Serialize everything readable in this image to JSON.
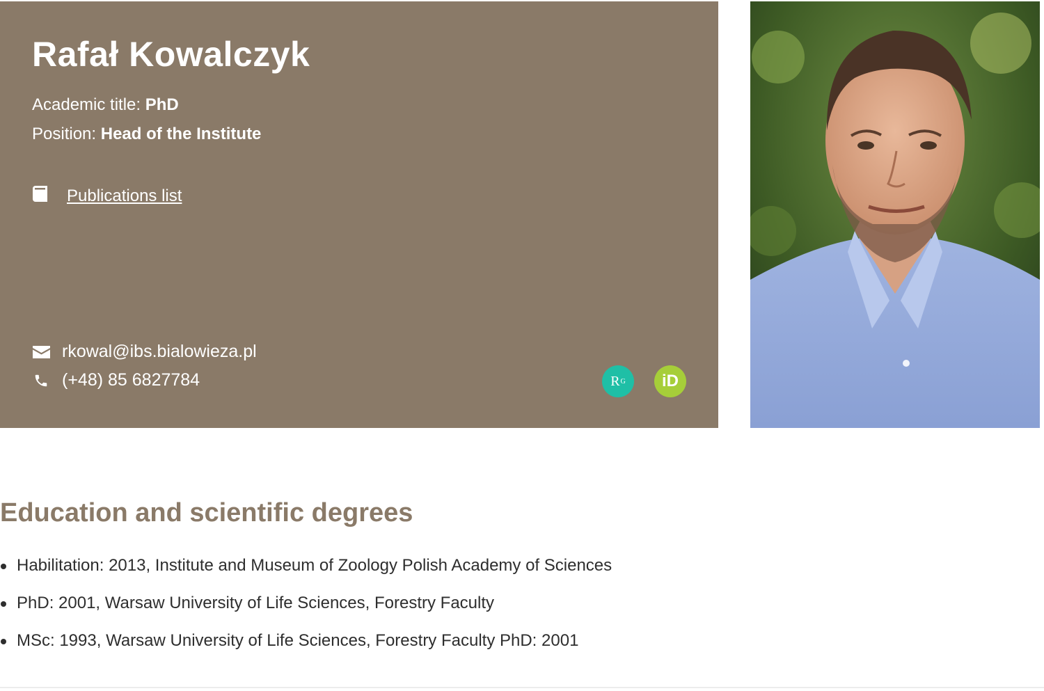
{
  "profile": {
    "name": "Rafał Kowalczyk",
    "academic_title_label": "Academic title:",
    "academic_title_value": "PhD",
    "position_label": "Position:",
    "position_value": "Head of the Institute",
    "publications_link": "Publications list",
    "email": "rkowal@ibs.bialowieza.pl",
    "phone": "(+48) 85 6827784",
    "researchgate_badge": "R",
    "researchgate_sup": "G",
    "orcid_badge": "iD",
    "card_color": "#8a7a68"
  },
  "icons": {
    "publications": "book-icon",
    "email": "envelope-icon",
    "phone": "phone-icon",
    "researchgate": "researchgate-icon",
    "orcid": "orcid-icon"
  },
  "colors": {
    "researchgate": "#1fbfa6",
    "orcid": "#a6ce39",
    "heading": "#8a7a68"
  },
  "education": {
    "heading": "Education and scientific degrees",
    "items": [
      "Habilitation: 2013, Institute and Museum of Zoology Polish Academy of Sciences",
      "PhD: 2001, Warsaw University of Life Sciences, Forestry Faculty",
      "MSc: 1993, Warsaw University of Life Sciences, Forestry Faculty PhD: 2001"
    ]
  }
}
